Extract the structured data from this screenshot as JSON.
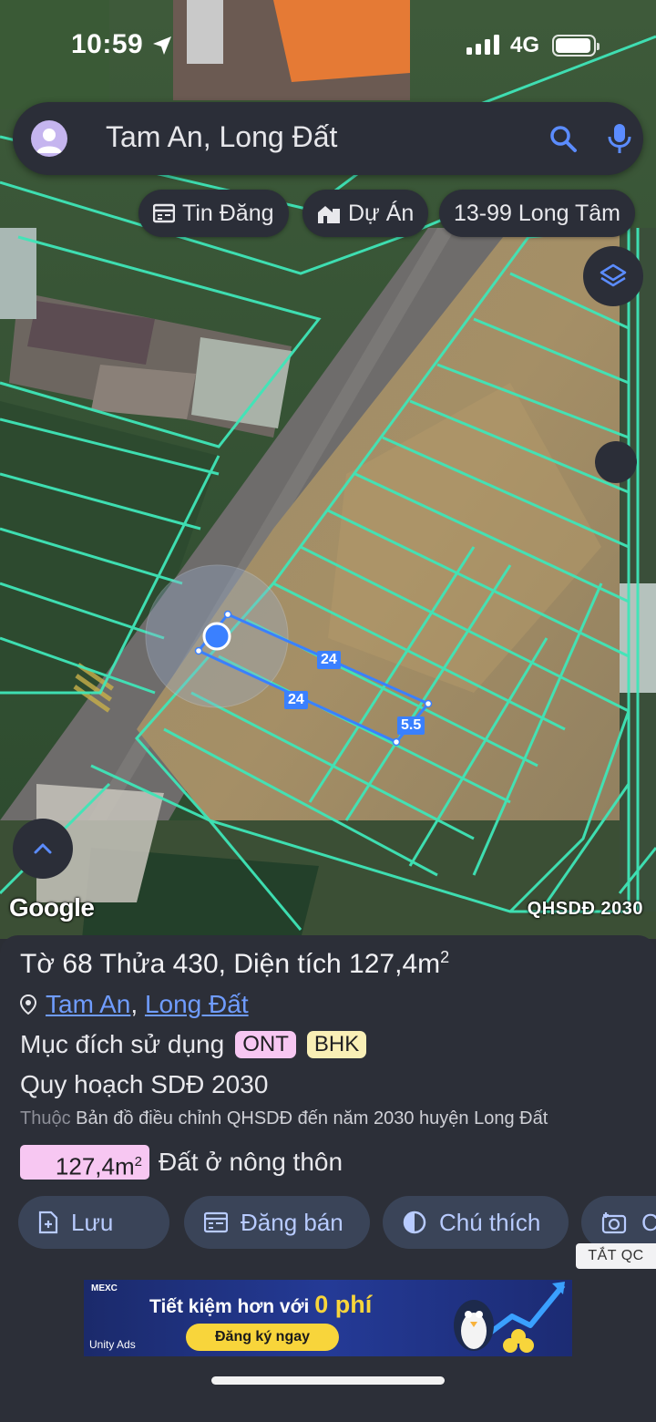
{
  "status_bar": {
    "time": "10:59",
    "network": "4G"
  },
  "search": {
    "query": "Tam An, Long Đất"
  },
  "chips": [
    {
      "label": "Tin Đăng",
      "icon": "calendar-list-icon"
    },
    {
      "label": "Dự Án",
      "icon": "buildings-icon"
    },
    {
      "label": "13-99 Long Tâm"
    }
  ],
  "map": {
    "attribution": "Google",
    "layer_label": "QHSDĐ 2030",
    "dimensions": [
      "24",
      "24",
      "5.5"
    ]
  },
  "parcel": {
    "title": "Tờ 68 Thửa 430, Diện tích 127,4m",
    "title_sup": "2",
    "address_parts": [
      "Tam An",
      "Long Đất"
    ],
    "address_sep": ",",
    "purpose_label": "Mục đích sử dụng",
    "purpose_codes": [
      "ONT",
      "BHK"
    ],
    "plan": "Quy hoạch SDĐ 2030",
    "belongs_prefix": "Thuộc",
    "belongs_text": "Bản đồ điều chỉnh QHSDĐ đến năm 2030 huyện Long Đất",
    "area_value": "127,4m",
    "area_sup": "2",
    "area_type": "Đất ở nông thôn"
  },
  "actions": [
    {
      "label": "Lưu",
      "icon": "file-add-icon"
    },
    {
      "label": "Đăng bán",
      "icon": "calendar-list-icon"
    },
    {
      "label": "Chú thích",
      "icon": "half-circle-icon"
    },
    {
      "label": "C",
      "icon": "camera-icon"
    }
  ],
  "ad": {
    "hide_label": "TẮT QC",
    "brand": "MEXC",
    "headline": "Tiết kiệm hơn với",
    "headline_accent": "0 phí",
    "cta": "Đăng ký ngay",
    "network": "Unity Ads"
  },
  "colors": {
    "parcel_line": "#3fe6b8",
    "selection": "#3a80ff",
    "ont_badge": "#f7c7f2",
    "bhk_badge": "#f9efb6",
    "link": "#6f9cff"
  }
}
